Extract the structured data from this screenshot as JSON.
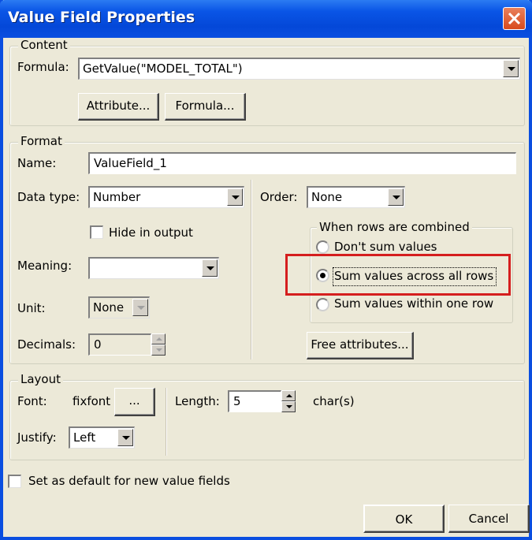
{
  "window": {
    "title": "Value Field Properties"
  },
  "content": {
    "legend": "Content",
    "formula_label": "Formula:",
    "formula_value": "GetValue(\"MODEL_TOTAL\")",
    "attribute_button": "Attribute...",
    "formula_button": "Formula..."
  },
  "format": {
    "legend": "Format",
    "name_label": "Name:",
    "name_value": "ValueField_1",
    "datatype_label": "Data type:",
    "datatype_value": "Number",
    "hide_output_label": "Hide in output",
    "hide_output_checked": false,
    "meaning_label": "Meaning:",
    "meaning_value": "",
    "unit_label": "Unit:",
    "unit_value": "None",
    "decimals_label": "Decimals:",
    "decimals_value": "0",
    "order_label": "Order:",
    "order_value": "None",
    "combine": {
      "legend": "When rows are combined",
      "options": [
        "Don't sum values",
        "Sum values across all rows",
        "Sum values within one row"
      ],
      "selected": "Sum values across all rows"
    },
    "free_attributes_button": "Free attributes..."
  },
  "layout": {
    "legend": "Layout",
    "font_label": "Font:",
    "font_value": "fixfont",
    "font_button": "...",
    "length_label": "Length:",
    "length_value": "5",
    "length_unit": "char(s)",
    "justify_label": "Justify:",
    "justify_value": "Left"
  },
  "default_checkbox_label": "Set as default for new value fields",
  "default_checked": false,
  "ok_button": "OK",
  "cancel_button": "Cancel",
  "colors": {
    "titlebar": "#0a4ee0",
    "highlight": "#d51e1e",
    "dialog_bg": "#ece9d8"
  }
}
